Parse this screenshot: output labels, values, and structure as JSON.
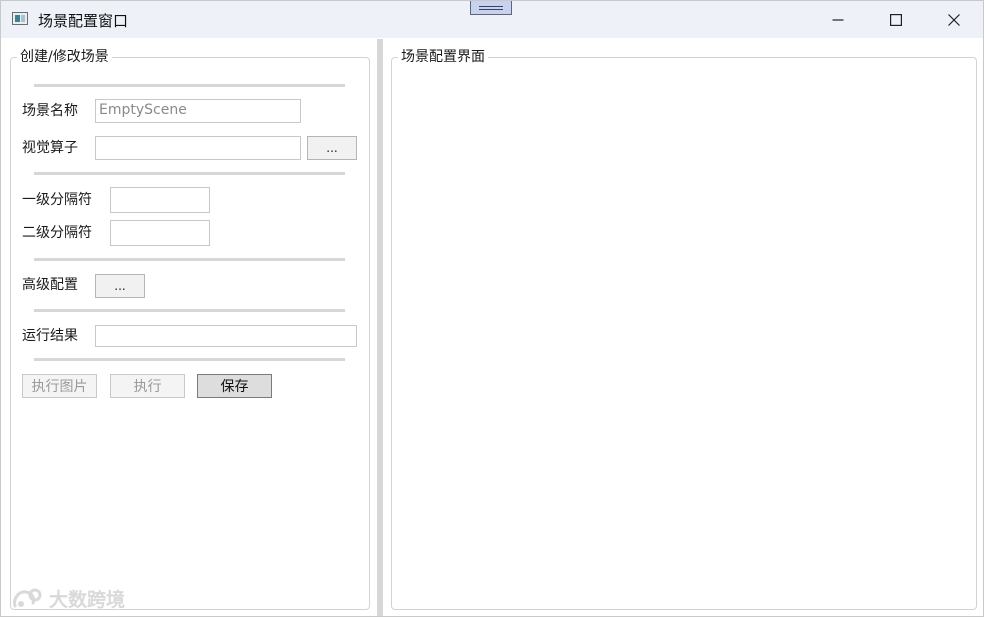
{
  "window": {
    "title": "场景配置窗口",
    "controls": [
      "minimize-icon",
      "maximize-icon",
      "close-icon"
    ]
  },
  "left_panel": {
    "title": "创建/修改场景",
    "scene_name_label": "场景名称",
    "scene_name_value": "EmptyScene",
    "operator_label": "视觉算子",
    "operator_value": "",
    "operator_browse_label": "...",
    "level1_sep_label": "一级分隔符",
    "level1_sep_value": "",
    "level2_sep_label": "二级分隔符",
    "level2_sep_value": "",
    "advanced_label": "高级配置",
    "advanced_button_label": "...",
    "result_label": "运行结果",
    "result_value": "",
    "run_image_label": "执行图片",
    "run_label": "执行",
    "save_label": "保存"
  },
  "right_panel": {
    "title": "场景配置界面"
  },
  "watermark": {
    "text": "大数跨境"
  },
  "colors": {
    "titlebar": "#eef2f8",
    "border": "#d3d3d3",
    "splitter": "#d7d7d7"
  }
}
